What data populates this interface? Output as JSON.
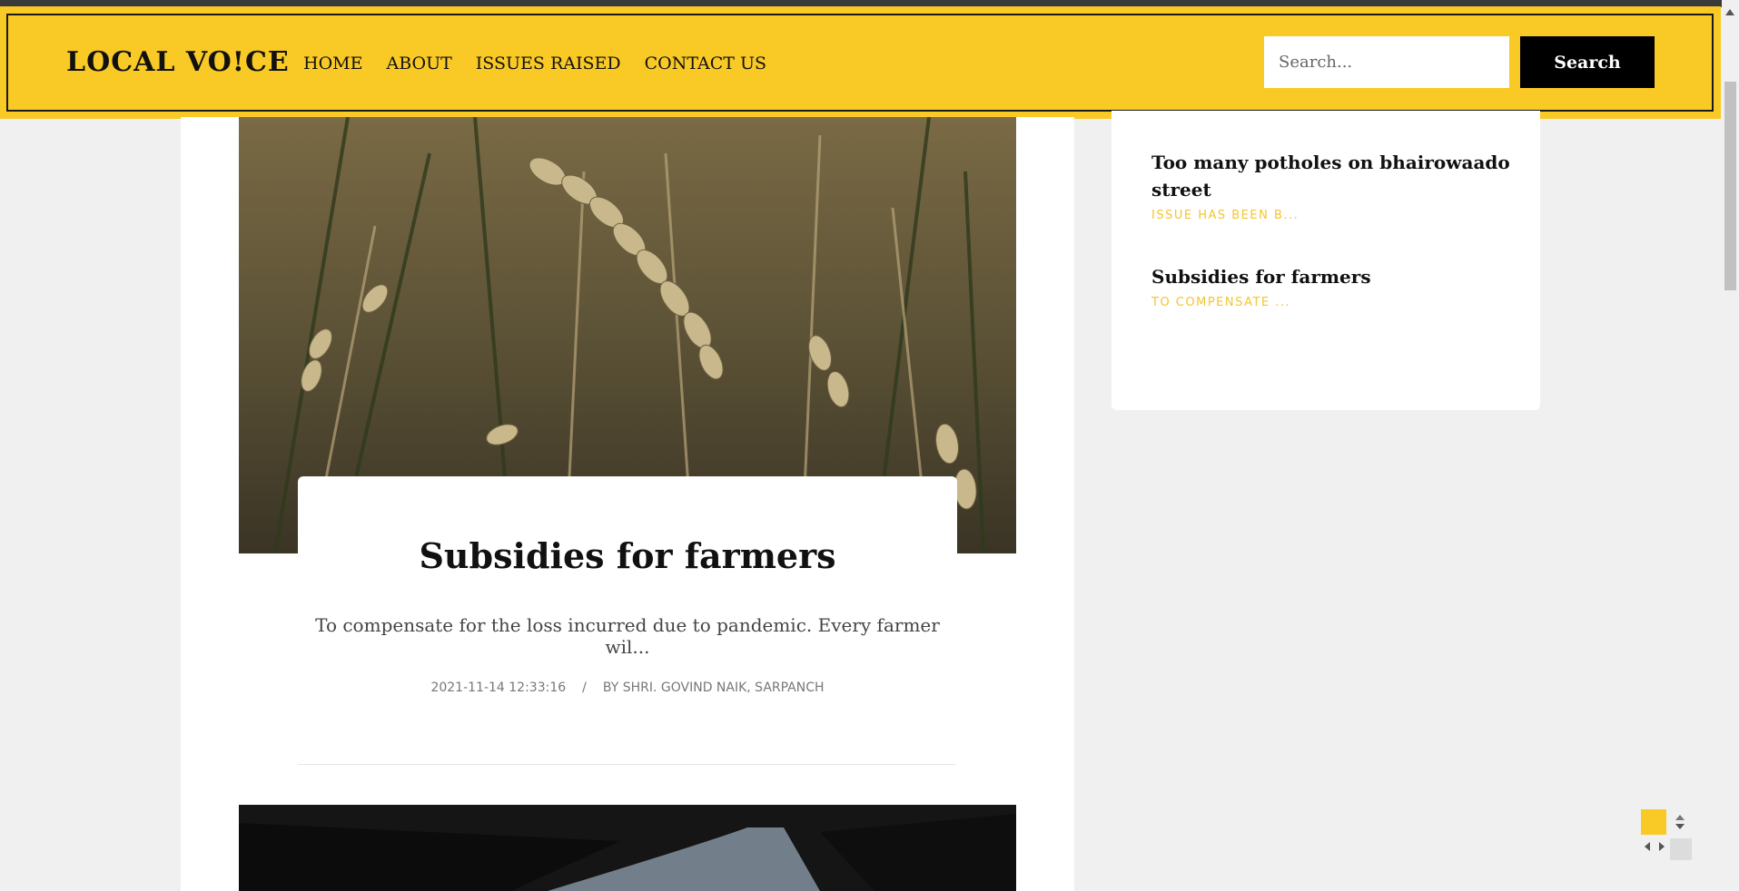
{
  "navbar": {
    "logo": "LOCAL VO!CE",
    "links": [
      "HOME",
      "ABOUT",
      "ISSUES RAISED",
      "CONTACT US"
    ],
    "search_placeholder": "Search...",
    "search_button": "Search"
  },
  "post": {
    "title": "Subsidies for farmers",
    "excerpt": "To compensate for the loss incurred due to pandemic. Every farmer wil...",
    "date": "2021-11-14 12:33:16",
    "separator": "/",
    "author": "BY SHRI. GOVIND NAIK, SARPANCH"
  },
  "sidebar": {
    "items": [
      {
        "title": "Too many potholes on bhairowaado street",
        "subtitle": "ISSUE HAS BEEN B..."
      },
      {
        "title": "Subsidies for farmers",
        "subtitle": "TO COMPENSATE ..."
      }
    ]
  },
  "colors": {
    "accent": "#f9c925",
    "sidebar_subtitle": "#f5c52c"
  }
}
